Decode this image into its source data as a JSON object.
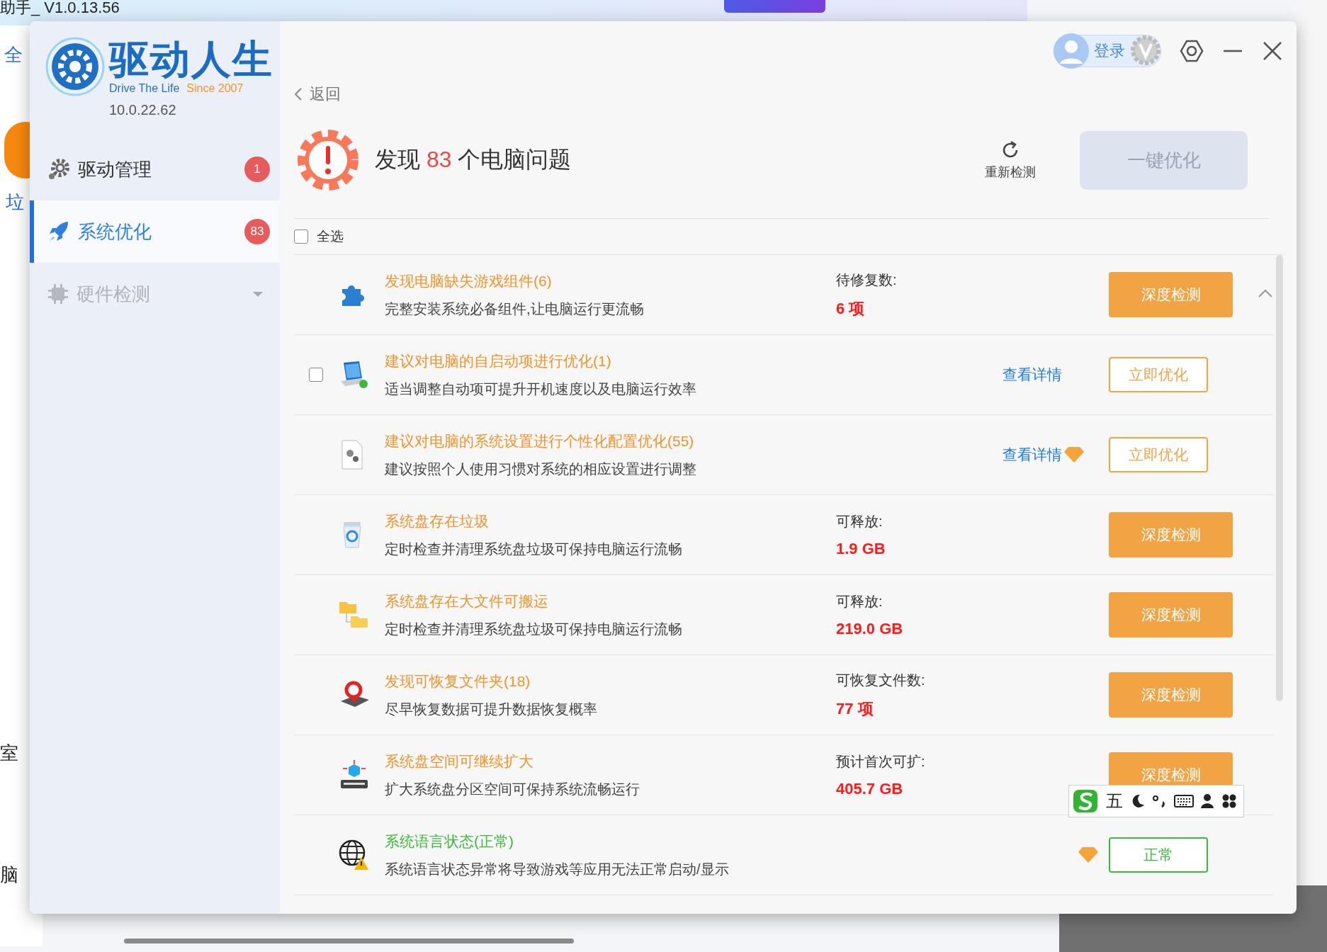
{
  "backdrop": {
    "title": "助手_ V1.0.13.56",
    "texts": [
      "全",
      "垃",
      "室",
      "脑"
    ]
  },
  "app": {
    "logo_title": "驱动人生",
    "logo_tagline": "Drive The Life",
    "logo_since": "Since 2007",
    "version": "10.0.22.62"
  },
  "sidebar": {
    "items": [
      {
        "label": "驱动管理",
        "badge": "1",
        "selected": false,
        "disabled": false
      },
      {
        "label": "系统优化",
        "badge": "83",
        "selected": true,
        "disabled": false
      },
      {
        "label": "硬件检测",
        "selected": false,
        "disabled": true,
        "expanded": false
      }
    ]
  },
  "topbar": {
    "login": "登录"
  },
  "back": "返回",
  "header": {
    "title_prefix": "发现",
    "count": "83",
    "title_suffix": "个电脑问题",
    "rescan": "重新检测",
    "one_click": {
      "label": "一键优化",
      "disabled": true
    }
  },
  "select_all": {
    "label": "全选",
    "checked": false
  },
  "rows": [
    {
      "kind": "deep",
      "title": "发现电脑缺失游戏组件(6)",
      "desc": "完整安装系统必备组件,让电脑运行更流畅",
      "metric_label": "待修复数:",
      "metric_value": "6 项",
      "action": "深度检测",
      "expanded": true
    },
    {
      "kind": "optimize",
      "checked": false,
      "title": "建议对电脑的自启动项进行优化(1)",
      "desc": "适当调整自动项可提升开机速度以及电脑运行效率",
      "link": "查看详情",
      "action": "立即优化",
      "vip": false
    },
    {
      "kind": "optimize",
      "title": "建议对电脑的系统设置进行个性化配置优化(55)",
      "desc": "建议按照个人使用习惯对系统的相应设置进行调整",
      "link": "查看详情",
      "action": "立即优化",
      "vip": true
    },
    {
      "kind": "deep",
      "title": "系统盘存在垃圾",
      "desc": "定时检查并清理系统盘垃圾可保持电脑运行流畅",
      "metric_label": "可释放:",
      "metric_value": "1.9 GB",
      "action": "深度检测"
    },
    {
      "kind": "deep",
      "title": "系统盘存在大文件可搬运",
      "desc": "定时检查并清理系统盘垃圾可保持电脑运行流畅",
      "metric_label": "可释放:",
      "metric_value": "219.0 GB",
      "action": "深度检测"
    },
    {
      "kind": "deep",
      "title": "发现可恢复文件夹(18)",
      "desc": "尽早恢复数据可提升数据恢复概率",
      "metric_label": "可恢复文件数:",
      "metric_value": "77 项",
      "action": "深度检测"
    },
    {
      "kind": "deep",
      "title": "系统盘空间可继续扩大",
      "desc": "扩大系统盘分区空间可保持系统流畅运行",
      "metric_label": "预计首次可扩:",
      "metric_value": "405.7 GB",
      "action": "深度检测"
    },
    {
      "kind": "normal",
      "title": "系统语言状态(正常)",
      "desc": "系统语言状态异常将导致游戏等应用无法正常启动/显示",
      "action": "正常",
      "vip": true
    }
  ],
  "ime": {
    "mode": "五"
  }
}
